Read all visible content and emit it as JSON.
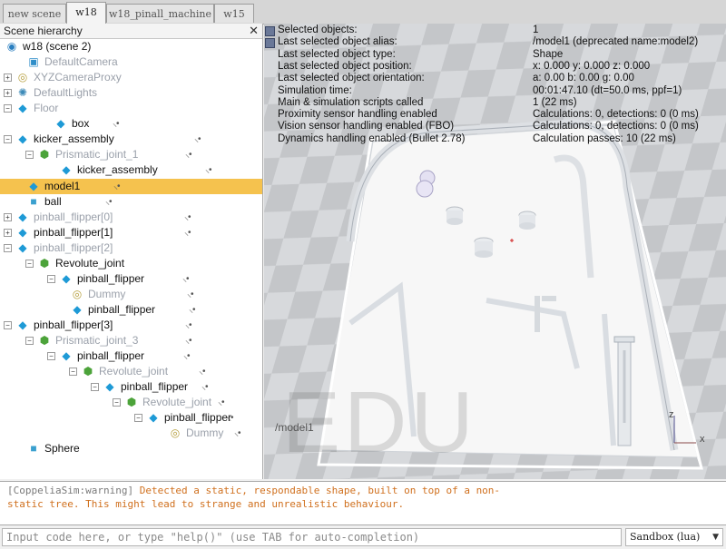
{
  "tabs": [
    {
      "label": "new scene",
      "active": false
    },
    {
      "label": "w18",
      "active": true
    },
    {
      "label": "w18_pinall_machine",
      "active": false
    },
    {
      "label": "w15",
      "active": false
    }
  ],
  "hierarchy": {
    "title": "Scene hierarchy",
    "close_glyph": "✕",
    "items": [
      {
        "label": "w18 (scene 2)",
        "icon": "scene-icon",
        "expander": "",
        "greyed": false,
        "selected": false
      },
      {
        "label": "DefaultCamera",
        "icon": "camera-icon",
        "expander": "",
        "greyed": true,
        "selected": false
      },
      {
        "label": "XYZCameraProxy",
        "icon": "dummy-icon",
        "expander": "+",
        "greyed": true,
        "selected": false
      },
      {
        "label": "DefaultLights",
        "icon": "light-icon",
        "expander": "+",
        "greyed": true,
        "selected": false
      },
      {
        "label": "Floor",
        "icon": "shape-icon",
        "expander": "−",
        "greyed": true,
        "selected": false
      },
      {
        "label": "box",
        "icon": "shape-icon",
        "expander": "",
        "greyed": false,
        "selected": false
      },
      {
        "label": "kicker_assembly",
        "icon": "shape-icon",
        "expander": "−",
        "greyed": false,
        "selected": false
      },
      {
        "label": "Prismatic_joint_1",
        "icon": "joint-icon",
        "expander": "−",
        "greyed": true,
        "selected": false
      },
      {
        "label": "kicker_assembly",
        "icon": "shape-icon",
        "expander": "",
        "greyed": false,
        "selected": false
      },
      {
        "label": "model1",
        "icon": "shape-icon",
        "expander": "",
        "greyed": false,
        "selected": true
      },
      {
        "label": "ball",
        "icon": "cube-icon",
        "expander": "",
        "greyed": false,
        "selected": false
      },
      {
        "label": "pinball_flipper[0]",
        "icon": "shape-icon",
        "expander": "+",
        "greyed": true,
        "selected": false
      },
      {
        "label": "pinball_flipper[1]",
        "icon": "shape-icon",
        "expander": "+",
        "greyed": false,
        "selected": false
      },
      {
        "label": "pinball_flipper[2]",
        "icon": "shape-icon",
        "expander": "−",
        "greyed": true,
        "selected": false
      },
      {
        "label": "Revolute_joint",
        "icon": "joint-icon",
        "expander": "−",
        "greyed": false,
        "selected": false
      },
      {
        "label": "pinball_flipper",
        "icon": "shape-icon",
        "expander": "−",
        "greyed": false,
        "selected": false
      },
      {
        "label": "Dummy",
        "icon": "dummy-icon",
        "expander": "",
        "greyed": true,
        "selected": false
      },
      {
        "label": "pinball_flipper",
        "icon": "shape-icon",
        "expander": "",
        "greyed": false,
        "selected": false
      },
      {
        "label": "pinball_flipper[3]",
        "icon": "shape-icon",
        "expander": "−",
        "greyed": false,
        "selected": false
      },
      {
        "label": "Prismatic_joint_3",
        "icon": "joint-icon",
        "expander": "−",
        "greyed": true,
        "selected": false
      },
      {
        "label": "pinball_flipper",
        "icon": "shape-icon",
        "expander": "−",
        "greyed": false,
        "selected": false
      },
      {
        "label": "Revolute_joint",
        "icon": "joint-icon",
        "expander": "−",
        "greyed": true,
        "selected": false
      },
      {
        "label": "pinball_flipper",
        "icon": "shape-icon",
        "expander": "−",
        "greyed": false,
        "selected": false
      },
      {
        "label": "Revolute_joint",
        "icon": "joint-icon",
        "expander": "−",
        "greyed": true,
        "selected": false
      },
      {
        "label": "pinball_flipper",
        "icon": "shape-icon",
        "expander": "−",
        "greyed": false,
        "selected": false
      },
      {
        "label": "Dummy",
        "icon": "dummy-icon",
        "expander": "",
        "greyed": true,
        "selected": false
      },
      {
        "label": "Sphere",
        "icon": "cube-icon",
        "expander": "",
        "greyed": false,
        "selected": false
      }
    ]
  },
  "info": [
    {
      "key": "Selected objects:",
      "value": "1"
    },
    {
      "key": "Last selected object alias:",
      "value": "/model1    (deprecated name:model2)"
    },
    {
      "key": "Last selected object type:",
      "value": "Shape"
    },
    {
      "key": "Last selected object position:",
      "value": "x: 0.000    y: 0.000    z: 0.000"
    },
    {
      "key": "Last selected object orientation:",
      "value": "a: 0.00    b: 0.00    g: 0.00"
    },
    {
      "key": "Simulation time:",
      "value": "00:01:47.10 (dt=50.0 ms, ppf=1)"
    },
    {
      "key": "Main & simulation scripts called",
      "value": "1 (22 ms)"
    },
    {
      "key": "Proximity sensor handling enabled",
      "value": "Calculations: 0, detections: 0 (0 ms)"
    },
    {
      "key": "Vision sensor handling enabled (FBO)",
      "value": "Calculations: 0, detections: 0 (0 ms)"
    },
    {
      "key": "Dynamics handling enabled (Bullet 2.78)",
      "value": "Calculation passes: 10 (22 ms)"
    }
  ],
  "view": {
    "watermark": "EDU",
    "model_label": "/model1",
    "axis_x": "x",
    "axis_z": "z"
  },
  "console": {
    "prefix": "[CoppeliaSim:warning]",
    "line1": " Detected a static, respondable shape, built on top of a non-",
    "line2": "static tree. This might lead to strange and unrealistic behaviour."
  },
  "command": {
    "placeholder": "Input code here, or type \"help()\" (use TAB for auto-completion)",
    "sandbox": "Sandbox (lua)"
  }
}
